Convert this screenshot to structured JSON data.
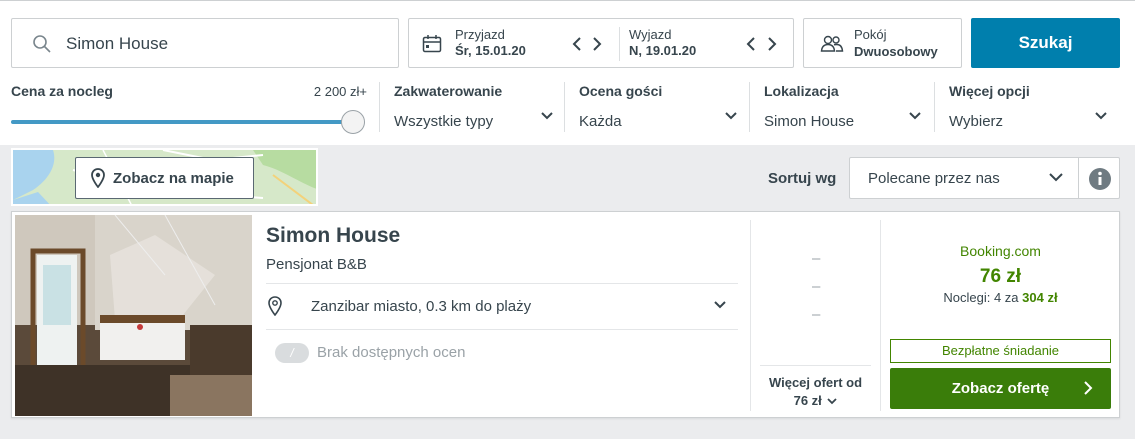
{
  "search": {
    "query": "Simon House"
  },
  "dates": {
    "checkin_label": "Przyjazd",
    "checkin_value": "Śr, 15.01.20",
    "checkout_label": "Wyjazd",
    "checkout_value": "N, 19.01.20"
  },
  "rooms": {
    "label": "Pokój",
    "value": "Dwuosobowy"
  },
  "search_button": "Szukaj",
  "filters": {
    "price": {
      "title": "Cena za nocleg",
      "max_label": "2 200 zł+",
      "slider_fraction": 1.0
    },
    "accommodation": {
      "title": "Zakwaterowanie",
      "value": "Wszystkie typy"
    },
    "rating": {
      "title": "Ocena gości",
      "value": "Każda"
    },
    "location": {
      "title": "Lokalizacja",
      "value": "Simon House"
    },
    "more": {
      "title": "Więcej opcji",
      "value": "Wybierz"
    }
  },
  "map": {
    "button_label": "Zobacz na mapie"
  },
  "sort": {
    "label": "Sortuj wg",
    "value": "Polecane przez nas"
  },
  "result": {
    "name": "Simon House",
    "type": "Pensjonat B&B",
    "location": "Zanzibar miasto, 0.3 km do plaży",
    "rating_badge": "/",
    "rating_text": "Brak dostępnych ocen",
    "placeholder_dash": "–",
    "more_offers_label": "Więcej ofert od",
    "more_offers_price": "76 zł",
    "deal": {
      "provider": "Booking.com",
      "price": "76 zł",
      "nights_prefix": "Noclegi: 4 za",
      "nights_total": "304 zł",
      "breakfast": "Bezpłatne śniadanie",
      "cta": "Zobacz ofertę"
    }
  },
  "colors": {
    "accent": "#007fad",
    "deal_green": "#428500",
    "cta_green": "#3a7d0a",
    "slider": "#4399c5"
  }
}
